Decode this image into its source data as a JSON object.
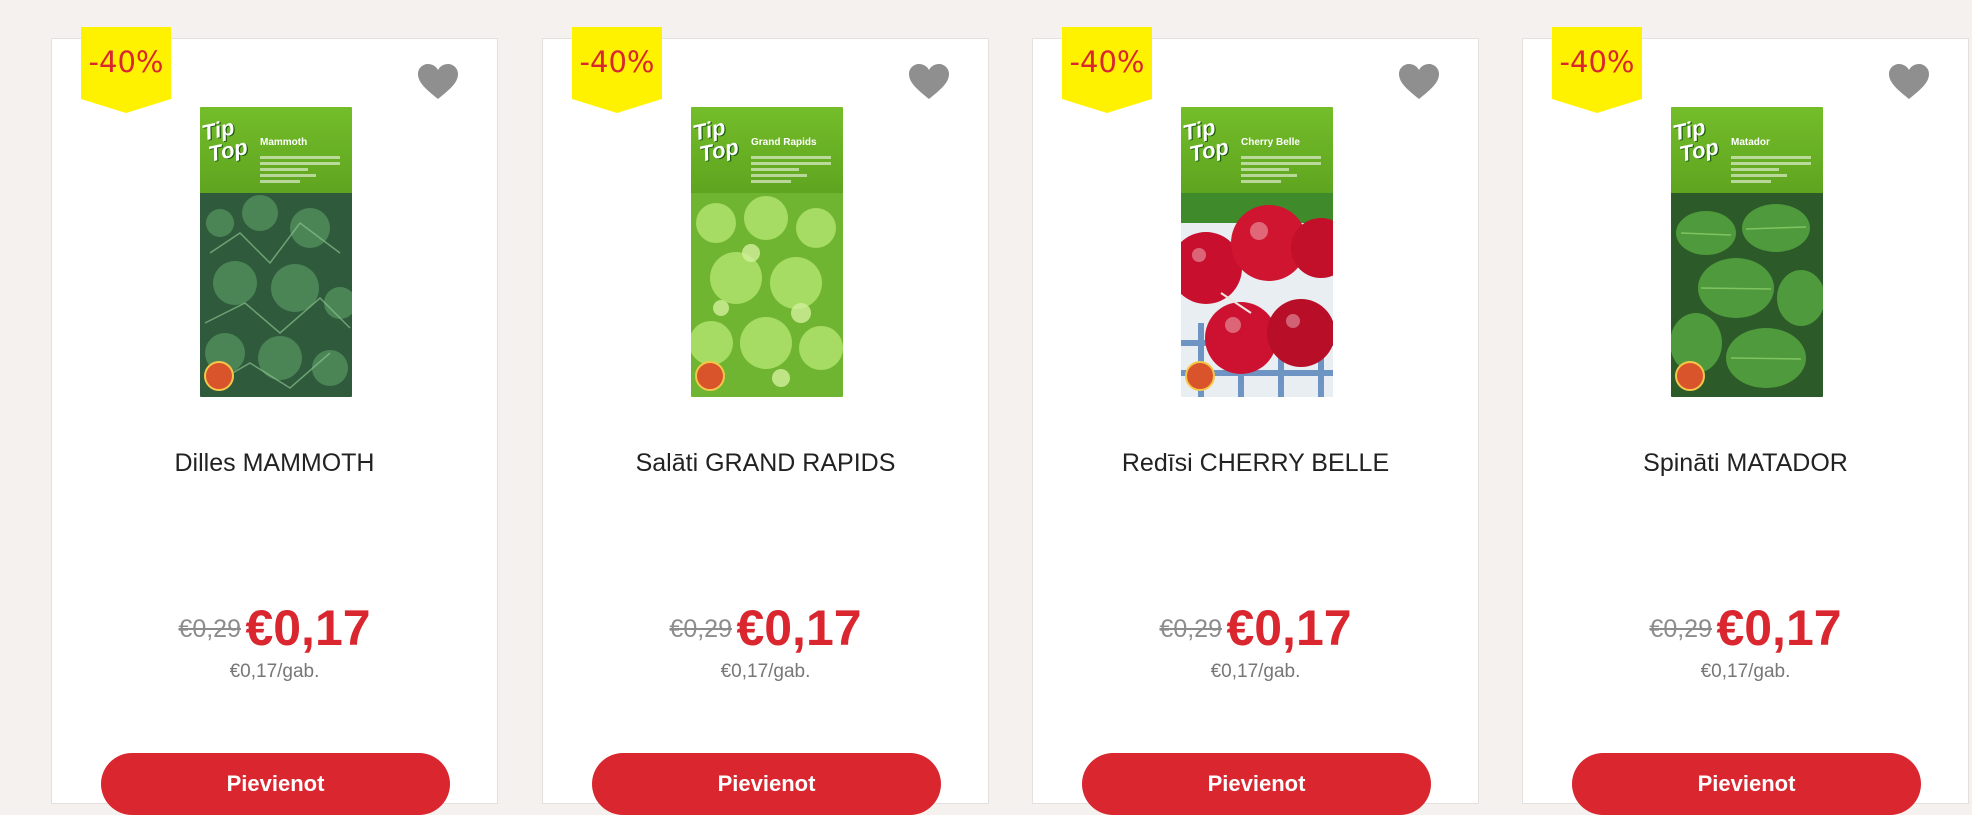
{
  "colors": {
    "accent": "#d9262f",
    "badge_bg": "#fff200",
    "heart": "#8f8f8f",
    "page_bg": "#f4f1ef"
  },
  "products": [
    {
      "discount": "-40%",
      "name": "Dilles MAMMOTH",
      "pack_title": "Mammoth",
      "brand_1": "Tip",
      "brand_2": "Top",
      "old_price": "€0,29",
      "price": "€0,17",
      "unit_price": "€0,17/gab.",
      "button": "Pievienot",
      "favorite_icon": "heart-icon"
    },
    {
      "discount": "-40%",
      "name": "Salāti GRAND RAPIDS",
      "pack_title": "Grand Rapids",
      "brand_1": "Tip",
      "brand_2": "Top",
      "old_price": "€0,29",
      "price": "€0,17",
      "unit_price": "€0,17/gab.",
      "button": "Pievienot",
      "favorite_icon": "heart-icon"
    },
    {
      "discount": "-40%",
      "name": "Redīsi CHERRY BELLE",
      "pack_title": "Cherry Belle",
      "brand_1": "Tip",
      "brand_2": "Top",
      "old_price": "€0,29",
      "price": "€0,17",
      "unit_price": "€0,17/gab.",
      "button": "Pievienot",
      "favorite_icon": "heart-icon"
    },
    {
      "discount": "-40%",
      "name": "Spināti MATADOR",
      "pack_title": "Matador",
      "brand_1": "Tip",
      "brand_2": "Top",
      "old_price": "€0,29",
      "price": "€0,17",
      "unit_price": "€0,17/gab.",
      "button": "Pievienot",
      "favorite_icon": "heart-icon"
    }
  ]
}
